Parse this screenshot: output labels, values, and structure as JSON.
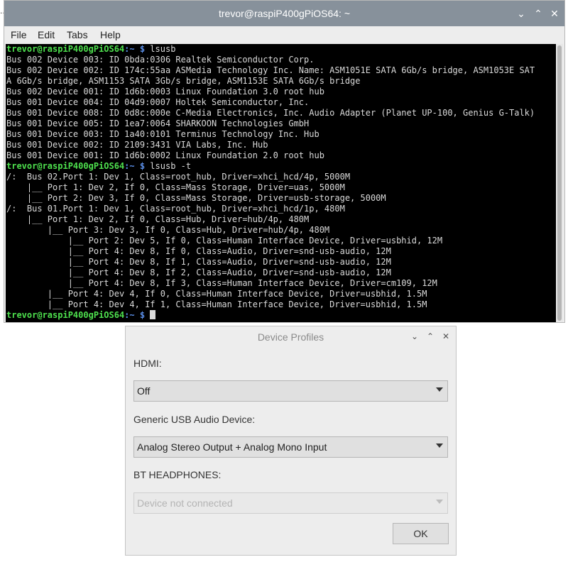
{
  "terminal": {
    "title": "trevor@raspiP400gPiOS64: ~",
    "menu": [
      "File",
      "Edit",
      "Tabs",
      "Help"
    ],
    "prompt_user": "trevor@raspiP400gPiOS64",
    "prompt_path": ":~ $",
    "cmd1": " lsusb",
    "lsusb_lines": [
      "Bus 002 Device 003: ID 0bda:0306 Realtek Semiconductor Corp.",
      "Bus 002 Device 002: ID 174c:55aa ASMedia Technology Inc. Name: ASM1051E SATA 6Gb/s bridge, ASM1053E SAT",
      "A 6Gb/s bridge, ASM1153 SATA 3Gb/s bridge, ASM1153E SATA 6Gb/s bridge",
      "Bus 002 Device 001: ID 1d6b:0003 Linux Foundation 3.0 root hub",
      "Bus 001 Device 004: ID 04d9:0007 Holtek Semiconductor, Inc.",
      "Bus 001 Device 008: ID 0d8c:000e C-Media Electronics, Inc. Audio Adapter (Planet UP-100, Genius G-Talk)",
      "Bus 001 Device 005: ID 1ea7:0064 SHARKOON Technologies GmbH",
      "Bus 001 Device 003: ID 1a40:0101 Terminus Technology Inc. Hub",
      "Bus 001 Device 002: ID 2109:3431 VIA Labs, Inc. Hub",
      "Bus 001 Device 001: ID 1d6b:0002 Linux Foundation 2.0 root hub"
    ],
    "cmd2": " lsusb -t",
    "tree_lines": [
      "/:  Bus 02.Port 1: Dev 1, Class=root_hub, Driver=xhci_hcd/4p, 5000M",
      "    |__ Port 1: Dev 2, If 0, Class=Mass Storage, Driver=uas, 5000M",
      "    |__ Port 2: Dev 3, If 0, Class=Mass Storage, Driver=usb-storage, 5000M",
      "/:  Bus 01.Port 1: Dev 1, Class=root_hub, Driver=xhci_hcd/1p, 480M",
      "    |__ Port 1: Dev 2, If 0, Class=Hub, Driver=hub/4p, 480M",
      "        |__ Port 3: Dev 3, If 0, Class=Hub, Driver=hub/4p, 480M",
      "            |__ Port 2: Dev 5, If 0, Class=Human Interface Device, Driver=usbhid, 12M",
      "            |__ Port 4: Dev 8, If 0, Class=Audio, Driver=snd-usb-audio, 12M",
      "            |__ Port 4: Dev 8, If 1, Class=Audio, Driver=snd-usb-audio, 12M",
      "            |__ Port 4: Dev 8, If 2, Class=Audio, Driver=snd-usb-audio, 12M",
      "            |__ Port 4: Dev 8, If 3, Class=Human Interface Device, Driver=cm109, 12M",
      "        |__ Port 4: Dev 4, If 0, Class=Human Interface Device, Driver=usbhid, 1.5M",
      "        |__ Port 4: Dev 4, If 1, Class=Human Interface Device, Driver=usbhid, 1.5M"
    ]
  },
  "dialog": {
    "title": "Device Profiles",
    "hdmi_label": "HDMI:",
    "hdmi_value": "Off",
    "usb_label": "Generic USB Audio Device:",
    "usb_value": "Analog Stereo Output + Analog Mono Input",
    "bt_label": "BT HEADPHONES:",
    "bt_value": "Device not connected",
    "ok_label": "OK"
  },
  "icons": {
    "minimize": "minimize-icon",
    "maximize": "maximize-icon",
    "close": "close-icon"
  }
}
